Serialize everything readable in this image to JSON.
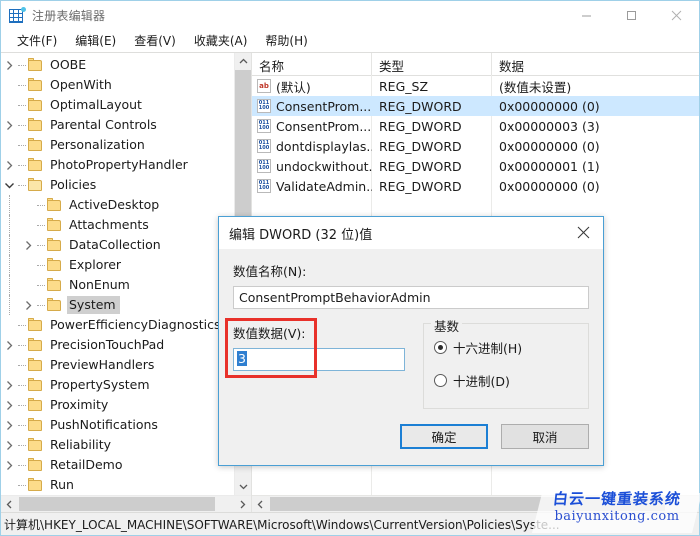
{
  "window": {
    "title": "注册表编辑器",
    "app_icon": "registry-icon",
    "minimize": "—",
    "maximize": "□",
    "close": "✕"
  },
  "menu": {
    "items": [
      {
        "label": "文件(F)"
      },
      {
        "label": "编辑(E)"
      },
      {
        "label": "查看(V)"
      },
      {
        "label": "收藏夹(A)"
      },
      {
        "label": "帮助(H)"
      }
    ]
  },
  "tree": {
    "items": [
      {
        "label": "OOBE",
        "indent": 1,
        "twisty": "right",
        "selected": false
      },
      {
        "label": "OpenWith",
        "indent": 1,
        "twisty": "none",
        "selected": false
      },
      {
        "label": "OptimalLayout",
        "indent": 1,
        "twisty": "none",
        "selected": false
      },
      {
        "label": "Parental Controls",
        "indent": 1,
        "twisty": "right",
        "selected": false
      },
      {
        "label": "Personalization",
        "indent": 1,
        "twisty": "none",
        "selected": false
      },
      {
        "label": "PhotoPropertyHandler",
        "indent": 1,
        "twisty": "right",
        "selected": false
      },
      {
        "label": "Policies",
        "indent": 1,
        "twisty": "down",
        "selected": false
      },
      {
        "label": "ActiveDesktop",
        "indent": 2,
        "twisty": "none",
        "selected": false
      },
      {
        "label": "Attachments",
        "indent": 2,
        "twisty": "none",
        "selected": false
      },
      {
        "label": "DataCollection",
        "indent": 2,
        "twisty": "right",
        "selected": false
      },
      {
        "label": "Explorer",
        "indent": 2,
        "twisty": "none",
        "selected": false
      },
      {
        "label": "NonEnum",
        "indent": 2,
        "twisty": "none",
        "selected": false
      },
      {
        "label": "System",
        "indent": 2,
        "twisty": "right",
        "selected": true
      },
      {
        "label": "PowerEfficiencyDiagnostics",
        "indent": 1,
        "twisty": "none",
        "selected": false
      },
      {
        "label": "PrecisionTouchPad",
        "indent": 1,
        "twisty": "right",
        "selected": false
      },
      {
        "label": "PreviewHandlers",
        "indent": 1,
        "twisty": "none",
        "selected": false
      },
      {
        "label": "PropertySystem",
        "indent": 1,
        "twisty": "right",
        "selected": false
      },
      {
        "label": "Proximity",
        "indent": 1,
        "twisty": "right",
        "selected": false
      },
      {
        "label": "PushNotifications",
        "indent": 1,
        "twisty": "right",
        "selected": false
      },
      {
        "label": "Reliability",
        "indent": 1,
        "twisty": "right",
        "selected": false
      },
      {
        "label": "RetailDemo",
        "indent": 1,
        "twisty": "right",
        "selected": false
      },
      {
        "label": "Run",
        "indent": 1,
        "twisty": "none",
        "selected": false
      }
    ]
  },
  "list": {
    "columns": [
      {
        "label": "名称"
      },
      {
        "label": "类型"
      },
      {
        "label": "数据"
      }
    ],
    "rows": [
      {
        "name": "(默认)",
        "type": "REG_SZ",
        "data": "(数值未设置)",
        "icon": "string-value-icon",
        "selected": false
      },
      {
        "name": "ConsentProm...",
        "type": "REG_DWORD",
        "data": "0x00000000 (0)",
        "icon": "dword-value-icon",
        "selected": true
      },
      {
        "name": "ConsentProm...",
        "type": "REG_DWORD",
        "data": "0x00000003 (3)",
        "icon": "dword-value-icon",
        "selected": false
      },
      {
        "name": "dontdisplaylas...",
        "type": "REG_DWORD",
        "data": "0x00000000 (0)",
        "icon": "dword-value-icon",
        "selected": false
      },
      {
        "name": "undockwithout...",
        "type": "REG_DWORD",
        "data": "0x00000001 (1)",
        "icon": "dword-value-icon",
        "selected": false
      },
      {
        "name": "ValidateAdmin...",
        "type": "REG_DWORD",
        "data": "0x00000000 (0)",
        "icon": "dword-value-icon",
        "selected": false
      }
    ]
  },
  "dialog": {
    "title": "编辑 DWORD (32 位)值",
    "name_label": "数值名称(N):",
    "name_value": "ConsentPromptBehaviorAdmin",
    "data_label": "数值数据(V):",
    "data_value": "3",
    "base_legend": "基数",
    "base_options": [
      {
        "label": "十六进制(H)",
        "selected": true
      },
      {
        "label": "十进制(D)",
        "selected": false
      }
    ],
    "ok_label": "确定",
    "cancel_label": "取消"
  },
  "statusbar": {
    "path": "计算机\\HKEY_LOCAL_MACHINE\\SOFTWARE\\Microsoft\\Windows\\CurrentVersion\\Policies\\Syste..."
  },
  "watermark": {
    "cn": "白云一键重装系统",
    "en": "baiyunxitong.com"
  },
  "colors": {
    "selection": "#cde8ff",
    "tree_selection": "#cfcfcf",
    "accent": "#1c7fd4",
    "annotation": "#e8312a",
    "folder": "#fcdc8a"
  }
}
